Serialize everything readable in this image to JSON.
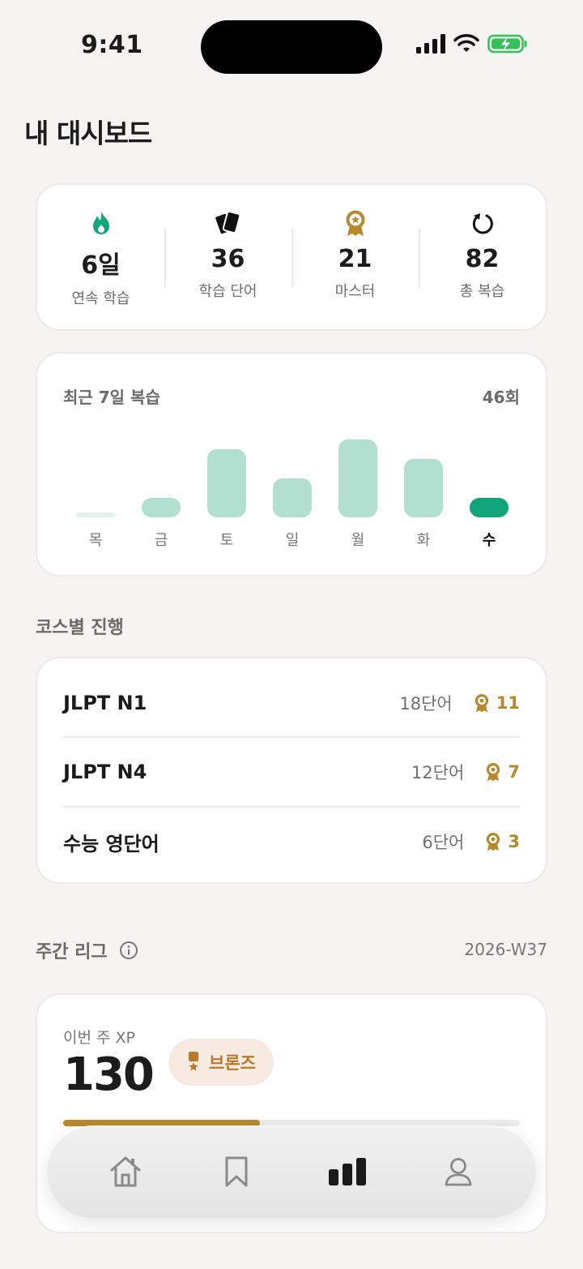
{
  "status_bar": {
    "time": "9:41"
  },
  "page_title": "내 대시보드",
  "stats": [
    {
      "icon": "flame-icon",
      "value": "6일",
      "label": "연속 학습"
    },
    {
      "icon": "cards-icon",
      "value": "36",
      "label": "학습 단어"
    },
    {
      "icon": "medal-icon",
      "value": "21",
      "label": "마스터"
    },
    {
      "icon": "refresh-icon",
      "value": "82",
      "label": "총 복습"
    }
  ],
  "weekly_chart": {
    "title": "최근 7일 복습",
    "total": "46회"
  },
  "chart_data": {
    "type": "bar",
    "categories": [
      "목",
      "금",
      "토",
      "일",
      "월",
      "화",
      "수"
    ],
    "values": [
      1,
      4,
      14,
      8,
      16,
      12,
      4
    ],
    "highlight_index": 6,
    "colors": {
      "bar": "#b1e0d0",
      "highlight": "#12a57a"
    }
  },
  "courses": {
    "title": "코스별 진행",
    "items": [
      {
        "name": "JLPT N1",
        "count": "18단어",
        "mastered": "11"
      },
      {
        "name": "JLPT N4",
        "count": "12단어",
        "mastered": "7"
      },
      {
        "name": "수능 영단어",
        "count": "6단어",
        "mastered": "3"
      }
    ]
  },
  "league": {
    "title": "주간 리그",
    "week": "2026-W37",
    "xp_label": "이번 주 XP",
    "xp_value": "130",
    "tier": "브론즈",
    "progress": 0.43
  },
  "tabs": [
    "home-icon",
    "bookmark-icon",
    "stats-icon",
    "profile-icon"
  ],
  "colors": {
    "accent_green": "#12a57a",
    "gold": "#b8892c",
    "bronze": "#b8782d"
  }
}
